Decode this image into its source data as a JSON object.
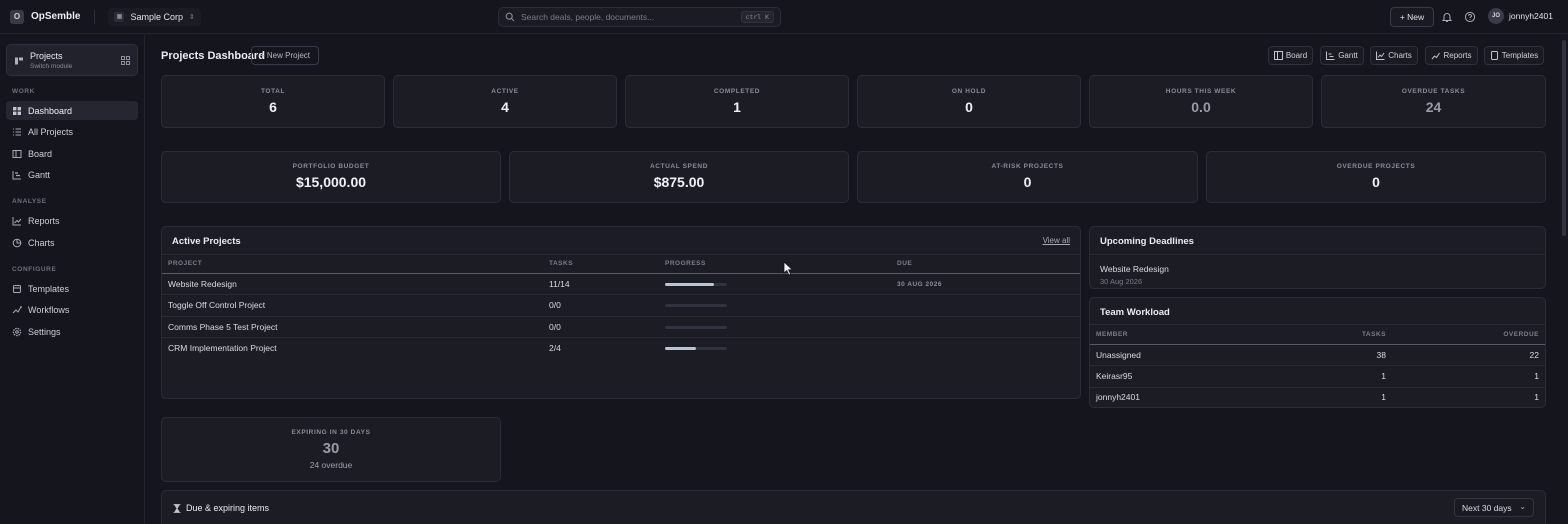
{
  "app": {
    "brand_initial": "O",
    "brand_name": "OpSemble",
    "org_name": "Sample Corp",
    "search_placeholder": "Search deals, people, documents...",
    "search_shortcut": "ctrl K",
    "new_label": "+ New",
    "user_initials": "JO",
    "user_name": "jonnyh2401",
    "icons": [
      "search-icon",
      "bell-icon",
      "help-icon",
      "grid-icon",
      "chevron-updown-icon"
    ]
  },
  "sidebar": {
    "module_title": "Projects",
    "module_sub": "Switch module",
    "sections": [
      {
        "label": "WORK",
        "items": [
          {
            "label": "Dashboard",
            "icon": "dashboard-icon",
            "active": true
          },
          {
            "label": "All Projects",
            "icon": "list-icon"
          },
          {
            "label": "Board",
            "icon": "board-icon"
          },
          {
            "label": "Gantt",
            "icon": "gantt-icon"
          }
        ]
      },
      {
        "label": "ANALYSE",
        "items": [
          {
            "label": "Reports",
            "icon": "reports-icon"
          },
          {
            "label": "Charts",
            "icon": "charts-icon"
          }
        ]
      },
      {
        "label": "CONFIGURE",
        "items": [
          {
            "label": "Templates",
            "icon": "templates-icon"
          },
          {
            "label": "Workflows",
            "icon": "workflows-icon"
          },
          {
            "label": "Settings",
            "icon": "settings-icon"
          }
        ]
      }
    ]
  },
  "header": {
    "title": "Projects Dashboard",
    "new_project": "+ New Project",
    "views": [
      "Board",
      "Gantt",
      "Charts",
      "Reports",
      "Templates"
    ]
  },
  "stats": [
    {
      "label": "TOTAL",
      "value": "6"
    },
    {
      "label": "ACTIVE",
      "value": "4"
    },
    {
      "label": "COMPLETED",
      "value": "1"
    },
    {
      "label": "ON HOLD",
      "value": "0"
    },
    {
      "label": "HOURS THIS WEEK",
      "value": "0.0"
    },
    {
      "label": "OVERDUE TASKS",
      "value": "24"
    }
  ],
  "finance": [
    {
      "label": "PORTFOLIO BUDGET",
      "value": "$15,000.00"
    },
    {
      "label": "ACTUAL SPEND",
      "value": "$875.00"
    },
    {
      "label": "AT-RISK PROJECTS",
      "value": "0"
    },
    {
      "label": "OVERDUE PROJECTS",
      "value": "0"
    }
  ],
  "active_projects": {
    "title": "Active Projects",
    "view_all": "View all",
    "columns": [
      "PROJECT",
      "TASKS",
      "PROGRESS",
      "DUE"
    ],
    "rows": [
      {
        "name": "Website Redesign",
        "tasks": "11/14",
        "progress": 0.786,
        "due": "30 AUG 2026"
      },
      {
        "name": "Toggle Off Control Project",
        "tasks": "0/0",
        "progress": 0,
        "due": ""
      },
      {
        "name": "Comms Phase 5 Test Project",
        "tasks": "0/0",
        "progress": 0,
        "due": ""
      },
      {
        "name": "CRM Implementation Project",
        "tasks": "2/4",
        "progress": 0.5,
        "due": ""
      }
    ]
  },
  "deadlines": {
    "title": "Upcoming Deadlines",
    "items": [
      {
        "name": "Website Redesign",
        "date": "30 Aug 2026"
      }
    ]
  },
  "workload": {
    "title": "Team Workload",
    "columns": [
      "MEMBER",
      "TASKS",
      "OVERDUE"
    ],
    "rows": [
      {
        "member": "Unassigned",
        "tasks": "38",
        "overdue": "22"
      },
      {
        "member": "Keirasr95",
        "tasks": "1",
        "overdue": "1"
      },
      {
        "member": "jonnyh2401",
        "tasks": "1",
        "overdue": "1"
      }
    ]
  },
  "expiring": {
    "label": "EXPIRING IN 30 DAYS",
    "value": "30",
    "sub": "24 overdue"
  },
  "due_items": {
    "title": "Due & expiring items",
    "range": "Next 30 days"
  }
}
